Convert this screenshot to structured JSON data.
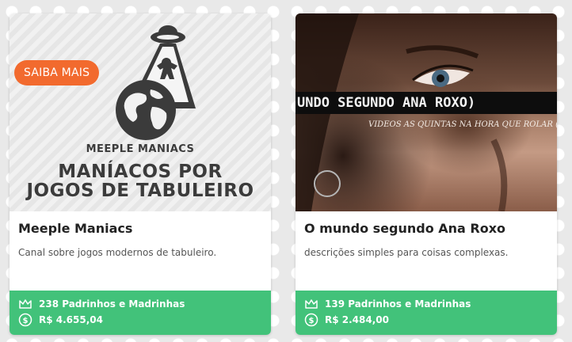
{
  "cards": [
    {
      "badge": "SAIBA MAIS",
      "image_text": {
        "brand_small": "MEEPLE MANIACS",
        "brand_line1": "MANÍACOS POR",
        "brand_line2": "JOGOS DE TABULEIRO"
      },
      "title": "Meeple Maniacs",
      "description": "Canal sobre jogos modernos de tabuleiro.",
      "patrons": "238 Padrinhos e Madrinhas",
      "amount": "R$ 4.655,04",
      "icons": [
        "crown-icon",
        "dollar-coin-icon"
      ]
    },
    {
      "image_text": {
        "banner": "UNDO SEGUNDO ANA ROXO)",
        "subtitle": "VÍDEOS ÀS QUINTAS NA HORA QUE ROLAR (TO ME ES"
      },
      "title": "O mundo segundo Ana Roxo",
      "description": "descrições simples para coisas complexas.",
      "patrons": "139 Padrinhos e Madrinhas",
      "amount": "R$ 2.484,00",
      "icons": [
        "crown-icon",
        "dollar-coin-icon"
      ]
    }
  ],
  "colors": {
    "badge": "#f26a2e",
    "stats_bar": "#42c27a",
    "background": "#e9e9e9"
  }
}
